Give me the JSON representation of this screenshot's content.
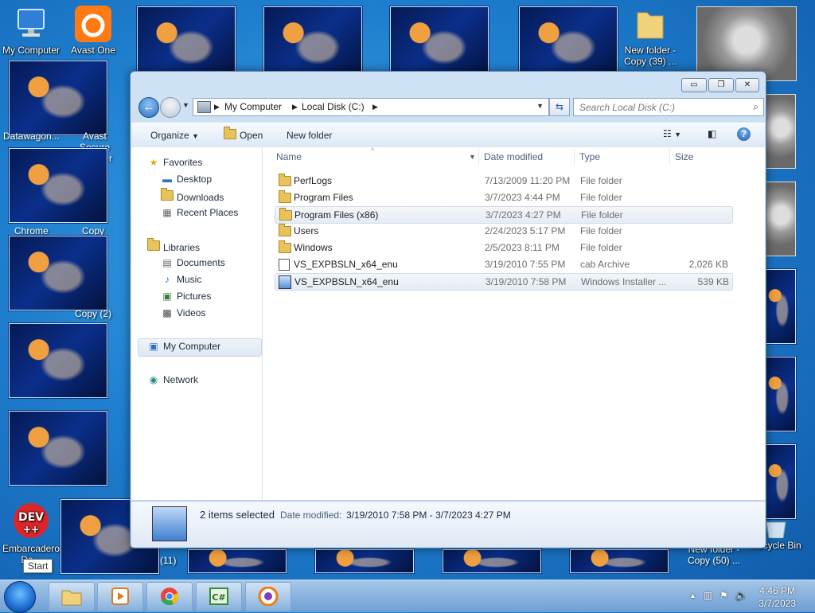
{
  "desktop": {
    "icons": [
      {
        "label": "My Computer"
      },
      {
        "label": "Avast One"
      },
      {
        "label": "Datawagon..."
      },
      {
        "label": "Avast Secure Browser"
      },
      {
        "label": "Chrome"
      },
      {
        "label": "Copy"
      },
      {
        "label": "Copy (2)"
      },
      {
        "label": "New folder - Copy (39) ..."
      },
      {
        "label": "Embarcadero De..."
      },
      {
        "label": "New folder - Copy (50) ..."
      },
      {
        "label": "Recycle Bin"
      },
      {
        "label": "(11)"
      }
    ]
  },
  "window": {
    "controls": {
      "minimize": "▭",
      "maximize": "❐",
      "close": "✕"
    },
    "breadcrumb": [
      "My Computer",
      "Local Disk (C:)"
    ],
    "search_placeholder": "Search Local Disk (C:)",
    "toolbar": {
      "organize": "Organize",
      "open": "Open",
      "new_folder": "New folder"
    },
    "nav_pane": {
      "favorites": "Favorites",
      "desktop": "Desktop",
      "downloads": "Downloads",
      "recent": "Recent Places",
      "libraries": "Libraries",
      "documents": "Documents",
      "music": "Music",
      "pictures": "Pictures",
      "videos": "Videos",
      "computer": "My Computer",
      "network": "Network"
    },
    "columns": {
      "name": "Name",
      "date": "Date modified",
      "type": "Type",
      "size": "Size"
    },
    "files": [
      {
        "name": "PerfLogs",
        "date": "7/13/2009 11:20 PM",
        "type": "File folder",
        "size": "",
        "kind": "folder",
        "selected": false
      },
      {
        "name": "Program Files",
        "date": "3/7/2023 4:44 PM",
        "type": "File folder",
        "size": "",
        "kind": "folder",
        "selected": false
      },
      {
        "name": "Program Files (x86)",
        "date": "3/7/2023 4:27 PM",
        "type": "File folder",
        "size": "",
        "kind": "folder",
        "selected": true
      },
      {
        "name": "Users",
        "date": "2/24/2023 5:17 PM",
        "type": "File folder",
        "size": "",
        "kind": "folder",
        "selected": false
      },
      {
        "name": "Windows",
        "date": "2/5/2023 8:11 PM",
        "type": "File folder",
        "size": "",
        "kind": "folder",
        "selected": false
      },
      {
        "name": "VS_EXPBSLN_x64_enu",
        "date": "3/19/2010 7:55 PM",
        "type": "cab Archive",
        "size": "2,026 KB",
        "kind": "cab",
        "selected": false
      },
      {
        "name": "VS_EXPBSLN_x64_enu",
        "date": "3/19/2010 7:58 PM",
        "type": "Windows Installer ...",
        "size": "539 KB",
        "kind": "msi",
        "selected": true
      }
    ],
    "details": {
      "count": "2 items selected",
      "date_label": "Date modified:",
      "date_value": "3/19/2010 7:58 PM - 3/7/2023 4:27 PM"
    }
  },
  "taskbar": {
    "tooltip": "Start",
    "time": "4:46 PM",
    "date": "3/7/2023"
  }
}
